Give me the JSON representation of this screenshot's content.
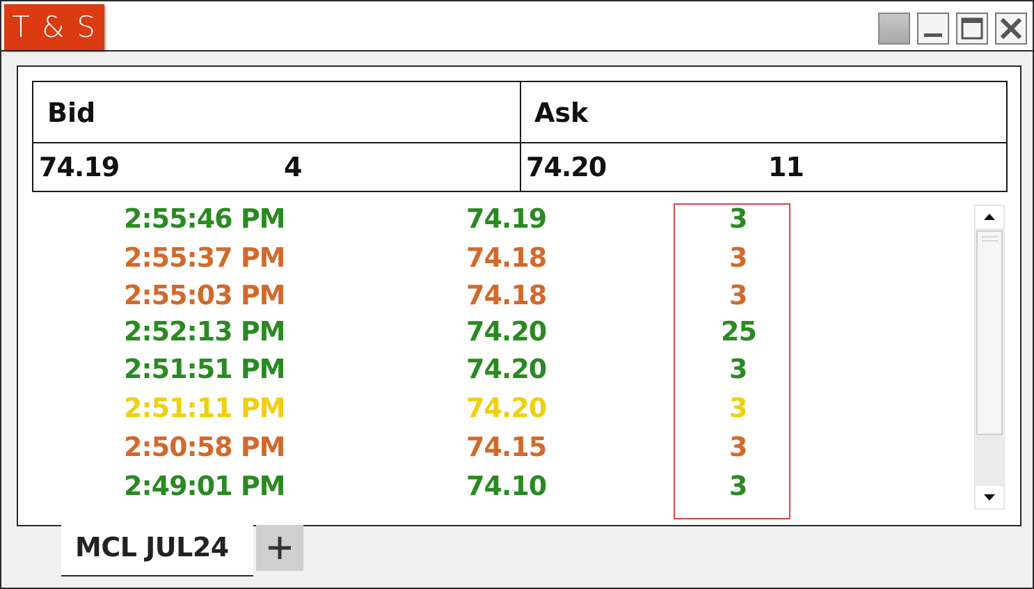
{
  "window": {
    "title": "T & S",
    "title_color": "#dc3a10",
    "controls": [
      "restore-gray-icon",
      "minimize-icon",
      "maximize-icon",
      "close-icon"
    ]
  },
  "quote": {
    "bid_header": "Bid",
    "ask_header": "Ask",
    "bid_price": "74.19",
    "bid_size": "4",
    "ask_price": "74.20",
    "ask_size": "11"
  },
  "colors": {
    "green": "#2a8a22",
    "orange": "#d2692b",
    "yellow": "#f0cf10",
    "highlight": "#e0474c"
  },
  "trades": [
    {
      "time": "2:55:46 PM",
      "price": "74.19",
      "size": "3",
      "color": "green"
    },
    {
      "time": "2:55:37 PM",
      "price": "74.18",
      "size": "3",
      "color": "orange"
    },
    {
      "time": "2:55:03 PM",
      "price": "74.18",
      "size": "3",
      "color": "orange"
    },
    {
      "time": "2:52:13 PM",
      "price": "74.20",
      "size": "25",
      "color": "green"
    },
    {
      "time": "2:51:51 PM",
      "price": "74.20",
      "size": "3",
      "color": "green"
    },
    {
      "time": "2:51:11 PM",
      "price": "74.20",
      "size": "3",
      "color": "yellow"
    },
    {
      "time": "2:50:58 PM",
      "price": "74.15",
      "size": "3",
      "color": "orange"
    },
    {
      "time": "2:49:01 PM",
      "price": "74.10",
      "size": "3",
      "color": "green"
    }
  ],
  "tabs": {
    "active_label": "MCL JUL24",
    "add_label": "+"
  }
}
